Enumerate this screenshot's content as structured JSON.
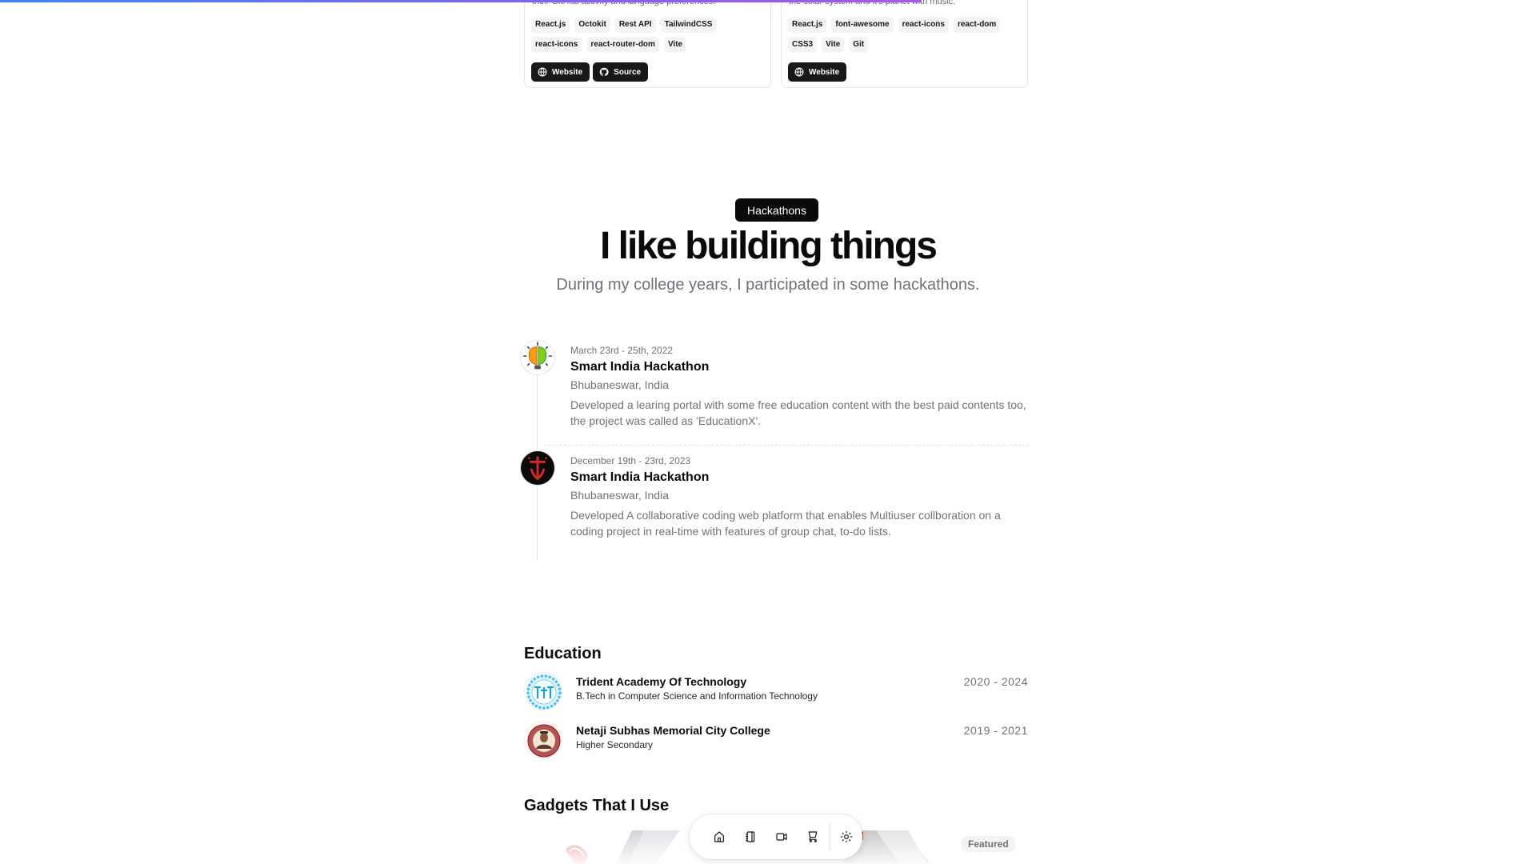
{
  "scroll_progress_percent": 60,
  "projects": [
    {
      "description": "their GitHub activity and language preferences.",
      "tags": [
        "React.js",
        "Octokit",
        "Rest API",
        "TailwindCSS",
        "react-icons",
        "react-router-dom",
        "Vite"
      ],
      "links": [
        {
          "label": "Website",
          "icon": "globe-icon"
        },
        {
          "label": "Source",
          "icon": "github-icon"
        }
      ]
    },
    {
      "description": "the solar system and it's planet with music.",
      "tags": [
        "React.js",
        "font-awesome",
        "react-icons",
        "react-dom",
        "CSS3",
        "Vite",
        "Git"
      ],
      "links": [
        {
          "label": "Website",
          "icon": "globe-icon"
        }
      ]
    }
  ],
  "hackathons": {
    "badge": "Hackathons",
    "title": "I like building things",
    "subtitle": "During my college years, I participated in some hackathons.",
    "items": [
      {
        "date": "March 23rd - 25th, 2022",
        "name": "Smart India Hackathon",
        "location": "Bhubaneswar, India",
        "description": "Developed a learing portal with some free education content with the best paid contents too, the project was called as 'EducationX'."
      },
      {
        "date": "December 19th - 23rd, 2023",
        "name": "Smart India Hackathon",
        "location": "Bhubaneswar, India",
        "description": "Developed A collaborative coding web platform that enables Multiuser collboration on a coding project in real-time with features of group chat, to-do lists."
      }
    ]
  },
  "education": {
    "title": "Education",
    "items": [
      {
        "school": "Trident Academy Of Technology",
        "degree": "B.Tech in Computer Science and Information Technology",
        "years": "2020 - 2024"
      },
      {
        "school": "Netaji Subhas Memorial City College",
        "degree": "Higher Secondary",
        "years": "2019 - 2021"
      }
    ]
  },
  "gadgets": {
    "title": "Gadgets That I Use",
    "badge": "Featured"
  },
  "dock": {
    "items": [
      {
        "name": "home",
        "icon": "home-icon"
      },
      {
        "name": "blog",
        "icon": "notebook-icon"
      },
      {
        "name": "videos",
        "icon": "video-icon"
      },
      {
        "name": "store",
        "icon": "cart-icon"
      },
      {
        "name": "theme-toggle",
        "icon": "sun-icon"
      }
    ]
  },
  "colors": {
    "progress_start": "#3b82f6",
    "progress_end": "#a855f7",
    "primary": "#0a0a0a",
    "muted": "#71717a"
  }
}
